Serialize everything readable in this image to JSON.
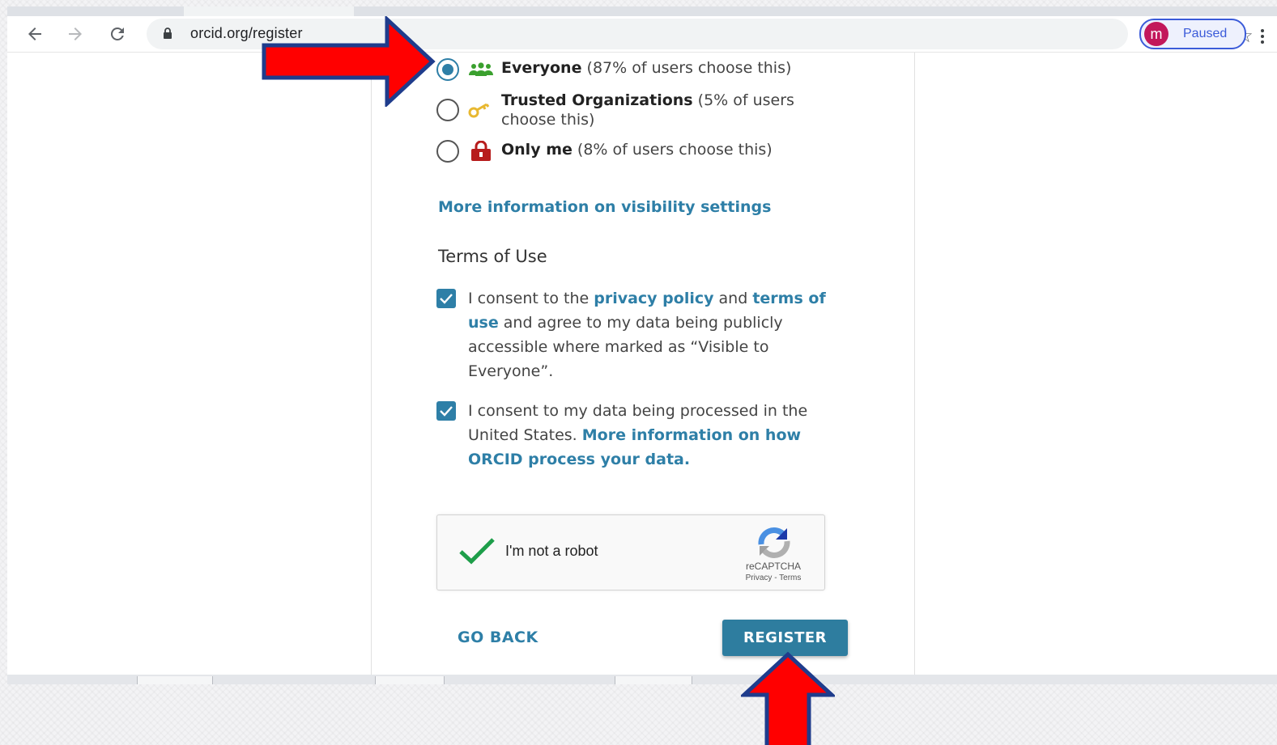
{
  "browser": {
    "url": "orcid.org/register",
    "profile_initial": "m",
    "profile_status": "Paused"
  },
  "visibility_options": [
    {
      "name": "Everyone",
      "detail": "(87% of users choose this)",
      "checked": true,
      "icon": "people-icon"
    },
    {
      "name": "Trusted Organizations",
      "detail": "(5% of users choose this)",
      "checked": false,
      "icon": "key-icon"
    },
    {
      "name": "Only me",
      "detail": "(8% of users choose this)",
      "checked": false,
      "icon": "lock-icon"
    }
  ],
  "more_info_link": "More information on visibility settings",
  "terms": {
    "heading": "Terms of Use",
    "consent1": {
      "prefix": "I consent to the ",
      "privacy_link": "privacy policy",
      "middle": " and ",
      "terms_link": "terms of use",
      "suffix": " and agree to my data being publicly accessible where marked as “Visible to Everyone”.",
      "checked": true
    },
    "consent2": {
      "prefix": "I consent to my data being processed in the United States. ",
      "link": "More information on how ORCID process your data.",
      "checked": true
    }
  },
  "captcha": {
    "label": "I'm not a robot",
    "brand": "reCAPTCHA",
    "links": "Privacy - Terms",
    "verified": true
  },
  "buttons": {
    "go_back": "GO BACK",
    "register": "REGISTER"
  },
  "colors": {
    "accent": "#2e7fa7",
    "arrow_fill": "#ff0000",
    "arrow_stroke": "#1f3c8c"
  }
}
